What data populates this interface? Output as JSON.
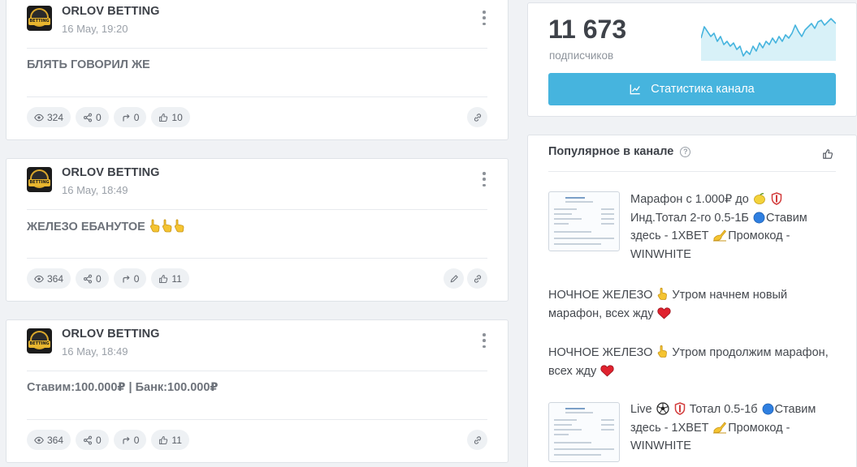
{
  "posts": [
    {
      "channel": "ORLOV BETTING",
      "date": "16 May, 19:20",
      "text": "БЛЯТЬ ГОВОРИЛ ЖЕ",
      "views": "324",
      "shares": "0",
      "forwards": "0",
      "likes": "10",
      "editable": false
    },
    {
      "channel": "ORLOV BETTING",
      "date": "16 May, 18:49",
      "text": "ЖЕЛЕЗО ЕБАНУТОЕ",
      "views": "364",
      "shares": "0",
      "forwards": "0",
      "likes": "11",
      "editable": true
    },
    {
      "channel": "ORLOV BETTING",
      "date": "16 May, 18:49",
      "text": "Ставим:100.000₽ | Банк:100.000₽",
      "views": "364",
      "shares": "0",
      "forwards": "0",
      "likes": "11",
      "editable": false
    }
  ],
  "sidebar": {
    "subscribers_count": "11 673",
    "subscribers_label": "подписчиков",
    "stats_button_label": "Статистика канала",
    "popular_title": "Популярное в канале",
    "popular": [
      {
        "lines": [
          "Марафон с 1.000₽ до",
          "Инд.Тотал 2-го 0.5-1Б",
          "Ставим",
          "здесь - 1XBET",
          "Промокод -",
          "WINWHITE"
        ]
      },
      {
        "lines": [
          "НОЧНОЕ ЖЕЛЕЗО",
          "Утром начнем новый",
          "марафон, всех жду"
        ]
      },
      {
        "lines": [
          "НОЧНОЕ ЖЕЛЕЗО",
          "Утром продолжим марафон,",
          "всех жду"
        ]
      },
      {
        "lines": [
          "Live",
          "Тотал 0.5-1б",
          "Ставим",
          "здесь - 1XBET",
          "Промокод -",
          "WINWHITE"
        ]
      }
    ]
  },
  "colors": {
    "accent": "#46b4de",
    "chart_fill": "#d8f1f8",
    "chart_line": "#46b4de"
  },
  "icons": [
    "eye-icon",
    "share-icon",
    "forward-icon",
    "thumbs-up-icon",
    "link-icon",
    "pencil-icon",
    "kebab-icon",
    "chart-line-icon",
    "help-icon"
  ]
}
